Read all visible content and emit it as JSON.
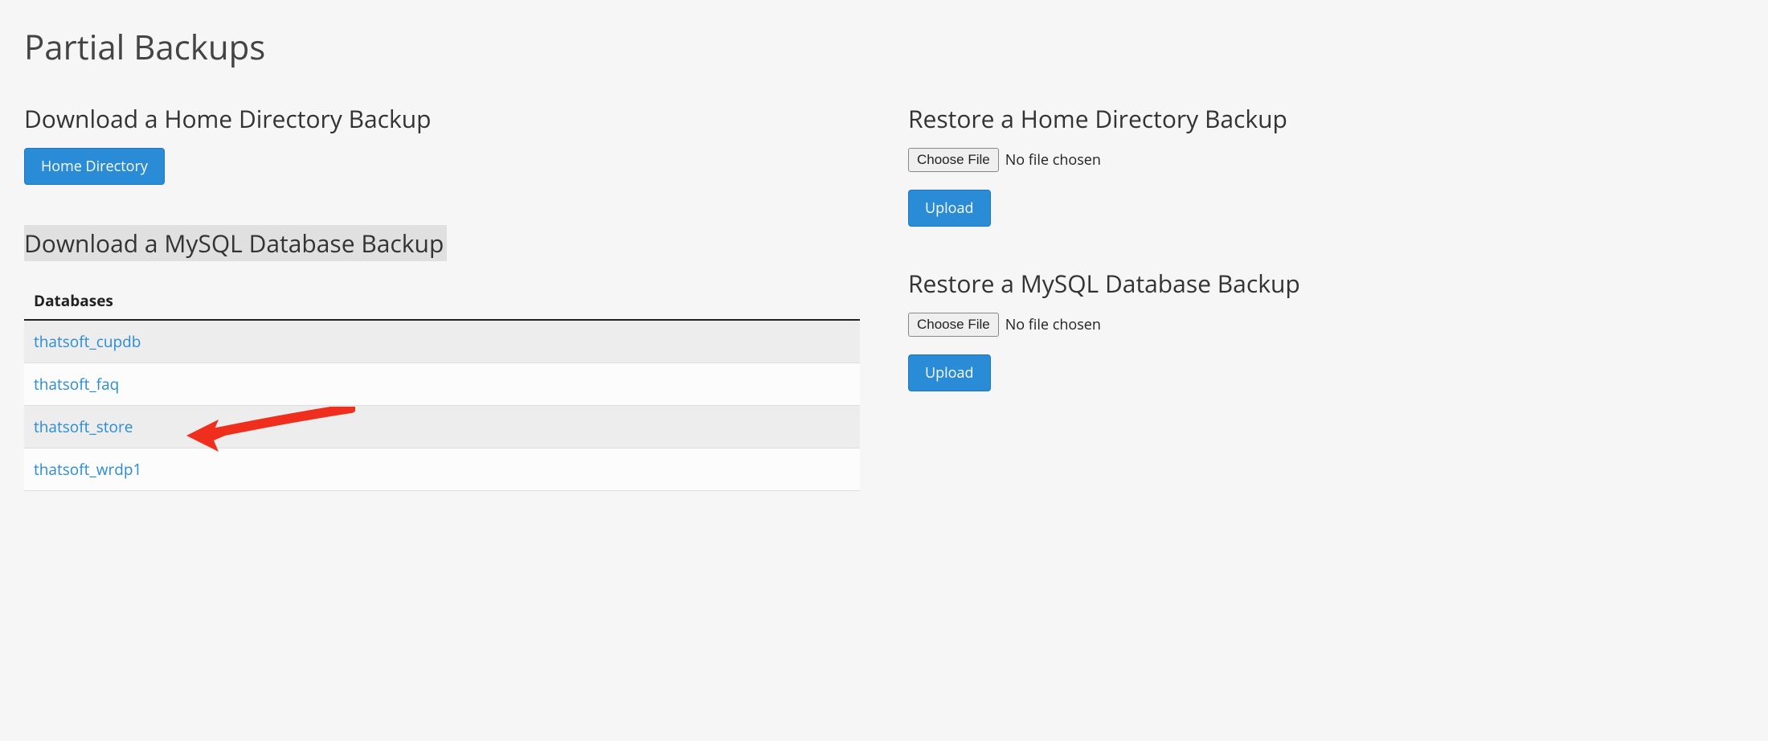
{
  "page_title": "Partial Backups",
  "left": {
    "download_home": {
      "heading": "Download a Home Directory Backup",
      "button_label": "Home Directory"
    },
    "download_mysql": {
      "heading": "Download a MySQL Database Backup",
      "table_header": "Databases",
      "databases": [
        "thatsoft_cupdb",
        "thatsoft_faq",
        "thatsoft_store",
        "thatsoft_wrdp1"
      ]
    }
  },
  "right": {
    "restore_home": {
      "heading": "Restore a Home Directory Backup",
      "choose_file_label": "Choose File",
      "file_status": "No file chosen",
      "upload_label": "Upload"
    },
    "restore_mysql": {
      "heading": "Restore a MySQL Database Backup",
      "choose_file_label": "Choose File",
      "file_status": "No file chosen",
      "upload_label": "Upload"
    }
  }
}
